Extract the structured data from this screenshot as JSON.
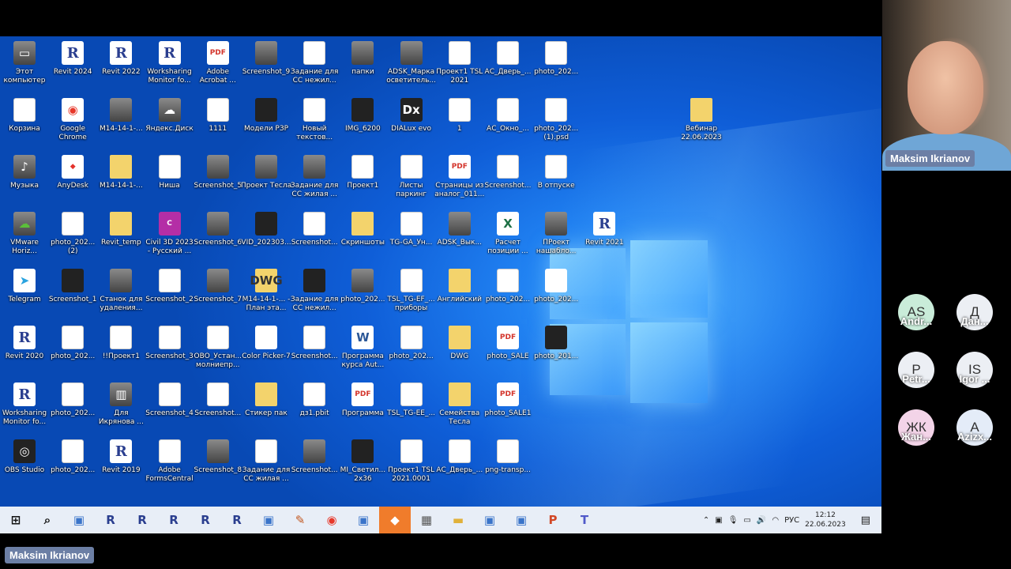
{
  "desktop_icons": [
    {
      "label": "Этот компьютер",
      "type": "pc",
      "col": 0,
      "row": 0
    },
    {
      "label": "Revit 2024",
      "type": "revit",
      "col": 1,
      "row": 0
    },
    {
      "label": "Revit 2022",
      "type": "revit",
      "col": 2,
      "row": 0
    },
    {
      "label": "Worksharing Monitor fo...",
      "type": "revit",
      "col": 3,
      "row": 0
    },
    {
      "label": "Adobe Acrobat ...",
      "type": "pdf",
      "col": 4,
      "row": 0
    },
    {
      "label": "Screenshot_9",
      "type": "img",
      "col": 5,
      "row": 0
    },
    {
      "label": "Задание для СС нежил...",
      "type": "doc",
      "col": 6,
      "row": 0
    },
    {
      "label": "папки",
      "type": "img",
      "col": 7,
      "row": 0
    },
    {
      "label": "ADSK_Марка осветитель...",
      "type": "img",
      "col": 8,
      "row": 0
    },
    {
      "label": "Проект1 TSL 2021",
      "type": "doc",
      "col": 9,
      "row": 0
    },
    {
      "label": "АС_Дверь_...",
      "type": "doc",
      "col": 10,
      "row": 0
    },
    {
      "label": "photo_202...",
      "type": "doc",
      "col": 11,
      "row": 0
    },
    {
      "label": "Корзина",
      "type": "bin",
      "col": 0,
      "row": 1
    },
    {
      "label": "Google Chrome",
      "type": "chrome",
      "col": 1,
      "row": 1
    },
    {
      "label": "M14-14-1-...",
      "type": "img",
      "col": 2,
      "row": 1
    },
    {
      "label": "Яндекс.Диск",
      "type": "yadisk",
      "col": 3,
      "row": 1
    },
    {
      "label": "1111",
      "type": "doc",
      "col": 4,
      "row": 1
    },
    {
      "label": "Модели РЗР",
      "type": "dark",
      "col": 5,
      "row": 1
    },
    {
      "label": "Новый текстов...",
      "type": "doc",
      "col": 6,
      "row": 1
    },
    {
      "label": "IMG_6200",
      "type": "dark",
      "col": 7,
      "row": 1
    },
    {
      "label": "DIALux evo",
      "type": "dialux",
      "col": 8,
      "row": 1
    },
    {
      "label": "1",
      "type": "doc",
      "col": 9,
      "row": 1
    },
    {
      "label": "АС_Окно_...",
      "type": "doc",
      "col": 10,
      "row": 1
    },
    {
      "label": "photo_202... (1).psd",
      "type": "doc",
      "col": 11,
      "row": 1
    },
    {
      "label": "Музыка",
      "type": "music",
      "col": 0,
      "row": 2
    },
    {
      "label": "AnyDesk",
      "type": "anydesk",
      "col": 1,
      "row": 2
    },
    {
      "label": "M14-14-1-...",
      "type": "folder",
      "col": 2,
      "row": 2
    },
    {
      "label": "Ниша",
      "type": "doc",
      "col": 3,
      "row": 2
    },
    {
      "label": "Screenshot_5",
      "type": "img",
      "col": 4,
      "row": 2
    },
    {
      "label": "Проект Тесла",
      "type": "img",
      "col": 5,
      "row": 2
    },
    {
      "label": "Задание для СС жилая ...",
      "type": "img",
      "col": 6,
      "row": 2
    },
    {
      "label": "Проект1",
      "type": "doc",
      "col": 7,
      "row": 2
    },
    {
      "label": "Листы паркинг",
      "type": "doc",
      "col": 8,
      "row": 2
    },
    {
      "label": "Страницы из аналог_011...",
      "type": "pdf",
      "col": 9,
      "row": 2
    },
    {
      "label": "Screenshot...",
      "type": "doc",
      "col": 10,
      "row": 2
    },
    {
      "label": "В отпуске",
      "type": "doc",
      "col": 11,
      "row": 2
    },
    {
      "label": "VMware Horiz...",
      "type": "vmware",
      "col": 0,
      "row": 3
    },
    {
      "label": "photo_202... (2)",
      "type": "doc",
      "col": 1,
      "row": 3
    },
    {
      "label": "Revit_temp",
      "type": "folder",
      "col": 2,
      "row": 3
    },
    {
      "label": "Civil 3D 2023 - Русский ...",
      "type": "civil",
      "col": 3,
      "row": 3
    },
    {
      "label": "Screenshot_6",
      "type": "img",
      "col": 4,
      "row": 3
    },
    {
      "label": "VID_202303...",
      "type": "dark",
      "col": 5,
      "row": 3
    },
    {
      "label": "Screenshot...",
      "type": "doc",
      "col": 6,
      "row": 3
    },
    {
      "label": "Скриншоты",
      "type": "folder",
      "col": 7,
      "row": 3
    },
    {
      "label": "TG-GA_Ун...",
      "type": "doc",
      "col": 8,
      "row": 3
    },
    {
      "label": "ADSK_Вык...",
      "type": "img",
      "col": 9,
      "row": 3
    },
    {
      "label": "Расчет позиции ...",
      "type": "excel",
      "col": 10,
      "row": 3
    },
    {
      "label": "ПРоект нашабло...",
      "type": "img",
      "col": 11,
      "row": 3
    },
    {
      "label": "Revit 2021",
      "type": "revit",
      "col": 12,
      "row": 3
    },
    {
      "label": "Telegram",
      "type": "telegram",
      "col": 0,
      "row": 4
    },
    {
      "label": "Screenshot_1",
      "type": "dark",
      "col": 1,
      "row": 4
    },
    {
      "label": "Станок для удаления...",
      "type": "img",
      "col": 2,
      "row": 4
    },
    {
      "label": "Screenshot_2",
      "type": "doc",
      "col": 3,
      "row": 4
    },
    {
      "label": "Screenshot_7",
      "type": "img",
      "col": 4,
      "row": 4
    },
    {
      "label": "M14-14-1-... - План эта...",
      "type": "dwg",
      "col": 5,
      "row": 4
    },
    {
      "label": "Задание для СС нежил...",
      "type": "dark",
      "col": 6,
      "row": 4
    },
    {
      "label": "photo_202...",
      "type": "img",
      "col": 7,
      "row": 4
    },
    {
      "label": "TSL_TG-EF_... приборы",
      "type": "doc",
      "col": 8,
      "row": 4
    },
    {
      "label": "Английский",
      "type": "folder",
      "col": 9,
      "row": 4
    },
    {
      "label": "photo_202...",
      "type": "doc",
      "col": 10,
      "row": 4
    },
    {
      "label": "photo_202...",
      "type": "color",
      "col": 11,
      "row": 4
    },
    {
      "label": "Revit 2020",
      "type": "revit",
      "col": 0,
      "row": 5
    },
    {
      "label": "photo_202...",
      "type": "doc",
      "col": 1,
      "row": 5
    },
    {
      "label": "!!Проект1",
      "type": "doc",
      "col": 2,
      "row": 5
    },
    {
      "label": "Screenshot_3",
      "type": "doc",
      "col": 3,
      "row": 5
    },
    {
      "label": "ОВО_Устан... молниепр...",
      "type": "doc",
      "col": 4,
      "row": 5
    },
    {
      "label": "Color Picker-7",
      "type": "color",
      "col": 5,
      "row": 5
    },
    {
      "label": "Screenshot...",
      "type": "doc",
      "col": 6,
      "row": 5
    },
    {
      "label": "Программа курса Aut...",
      "type": "word",
      "col": 7,
      "row": 5
    },
    {
      "label": "photo_202...",
      "type": "doc",
      "col": 8,
      "row": 5
    },
    {
      "label": "DWG",
      "type": "folder",
      "col": 9,
      "row": 5
    },
    {
      "label": "photo_SALE",
      "type": "pdf",
      "col": 10,
      "row": 5
    },
    {
      "label": "photo_201...",
      "type": "dark",
      "col": 11,
      "row": 5
    },
    {
      "label": "Worksharing Monitor fo...",
      "type": "revit",
      "col": 0,
      "row": 6
    },
    {
      "label": "photo_202...",
      "type": "doc",
      "col": 1,
      "row": 6
    },
    {
      "label": "Для Икрянова ...",
      "type": "rar",
      "col": 2,
      "row": 6
    },
    {
      "label": "Screenshot_4",
      "type": "doc",
      "col": 3,
      "row": 6
    },
    {
      "label": "Screenshot...",
      "type": "doc",
      "col": 4,
      "row": 6
    },
    {
      "label": "Стикер пак",
      "type": "folder",
      "col": 5,
      "row": 6
    },
    {
      "label": "дз1.pbit",
      "type": "doc",
      "col": 6,
      "row": 6
    },
    {
      "label": "Программа",
      "type": "pdf",
      "col": 7,
      "row": 6
    },
    {
      "label": "TSL_TG-EE_...",
      "type": "doc",
      "col": 8,
      "row": 6
    },
    {
      "label": "Семейства Тесла",
      "type": "folder",
      "col": 9,
      "row": 6
    },
    {
      "label": "photo_SALE1",
      "type": "pdf",
      "col": 10,
      "row": 6
    },
    {
      "label": "OBS Studio",
      "type": "obs",
      "col": 0,
      "row": 7
    },
    {
      "label": "photo_202...",
      "type": "doc",
      "col": 1,
      "row": 7
    },
    {
      "label": "Revit 2019",
      "type": "revit",
      "col": 2,
      "row": 7
    },
    {
      "label": "Adobe FormsCentral",
      "type": "doc",
      "col": 3,
      "row": 7
    },
    {
      "label": "Screenshot_8",
      "type": "img",
      "col": 4,
      "row": 7
    },
    {
      "label": "Задание для СС жилая ...",
      "type": "doc",
      "col": 5,
      "row": 7
    },
    {
      "label": "Screenshot...",
      "type": "img",
      "col": 6,
      "row": 7
    },
    {
      "label": "MI_Светил... 2x36",
      "type": "dark",
      "col": 7,
      "row": 7
    },
    {
      "label": "Проект1 TSL 2021.0001",
      "type": "doc",
      "col": 8,
      "row": 7
    },
    {
      "label": "АС_Дверь_...",
      "type": "doc",
      "col": 9,
      "row": 7
    },
    {
      "label": "png-transp...",
      "type": "doc",
      "col": 10,
      "row": 7
    }
  ],
  "webinar_icon": {
    "label": "Вебинар 22.06.2023"
  },
  "taskbar": {
    "apps": [
      "start-icon",
      "search-icon",
      "app-icon",
      "revit-icon",
      "revit-icon",
      "revit-icon",
      "revit-icon",
      "revit-icon",
      "app-icon",
      "paint-icon",
      "chrome-icon",
      "app-icon",
      "anydesk-icon",
      "calculator-icon",
      "folder-icon",
      "app-icon",
      "app-icon",
      "powerpoint-icon",
      "teams-icon"
    ],
    "lang": "РУС",
    "time": "12:12",
    "date": "22.06.2023"
  },
  "conference": {
    "self_name": "Maksim Ikrianov",
    "bottom_name": "Maksim Ikrianov",
    "participants": [
      {
        "initials": "AS",
        "name": "Andr...",
        "color": "#c9ecd9"
      },
      {
        "initials": "Д",
        "name": "Дан...",
        "color": "#eceff4"
      },
      {
        "initials": "P",
        "name": "Petr...",
        "color": "#eceff4"
      },
      {
        "initials": "IS",
        "name": "Igor ...",
        "color": "#eceff4"
      },
      {
        "initials": "ЖК",
        "name": "Жан...",
        "color": "#f3d4e8"
      },
      {
        "initials": "A",
        "name": "Azizx...",
        "color": "#e4ecf8"
      }
    ]
  }
}
